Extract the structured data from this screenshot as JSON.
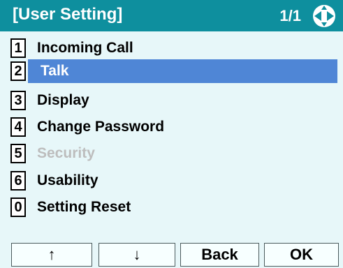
{
  "title": "[User Setting]",
  "page_indicator": "1/1",
  "nav_icon": "four-way-navigation-icon",
  "colors": {
    "title_bar": "#0e8f9e",
    "background": "#e7f7f9",
    "selected": "#4f86d6",
    "disabled_text": "#bdbdbd"
  },
  "menu": {
    "selected_index": 1,
    "items": [
      {
        "key": "1",
        "label": "Incoming Call",
        "state": "normal"
      },
      {
        "key": "2",
        "label": "Talk",
        "state": "selected"
      },
      {
        "key": "3",
        "label": "Display",
        "state": "normal"
      },
      {
        "key": "4",
        "label": "Change Password",
        "state": "normal"
      },
      {
        "key": "5",
        "label": "Security",
        "state": "disabled"
      },
      {
        "key": "6",
        "label": "Usability",
        "state": "normal"
      },
      {
        "key": "0",
        "label": "Setting Reset",
        "state": "normal"
      }
    ]
  },
  "softkeys": [
    {
      "label": "↑",
      "name": "up"
    },
    {
      "label": "↓",
      "name": "down"
    },
    {
      "label": "Back",
      "name": "back"
    },
    {
      "label": "OK",
      "name": "ok"
    }
  ]
}
